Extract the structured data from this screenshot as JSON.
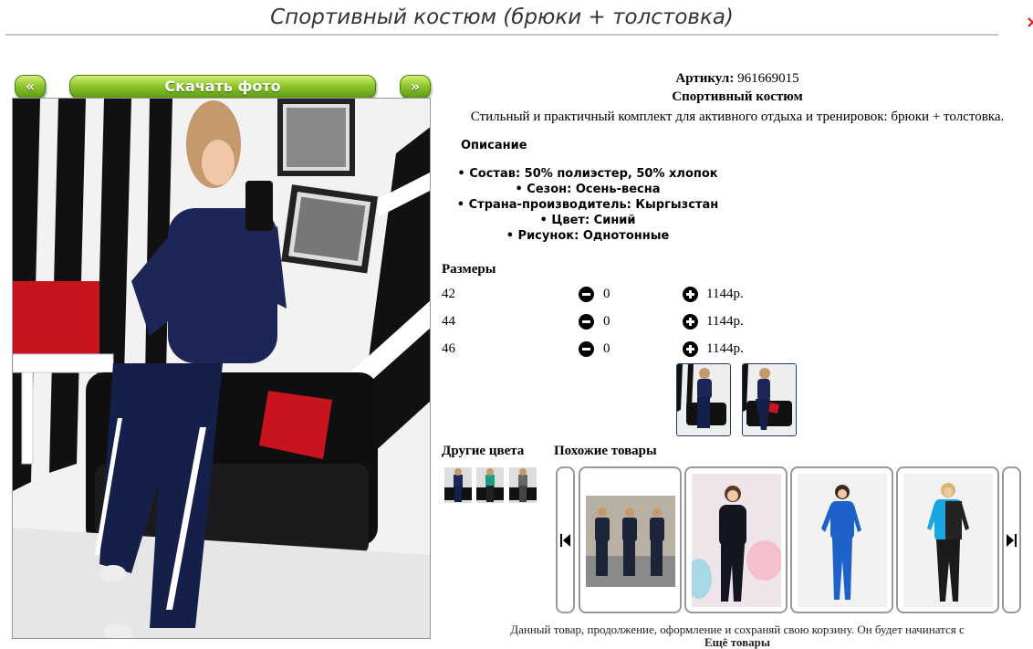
{
  "page": {
    "title": "Спортивный костюм (брюки + толстовка)",
    "close_icon": "close-icon"
  },
  "gallery": {
    "prev_label": "«",
    "download_label": "Скачать фото",
    "next_label": "»"
  },
  "product": {
    "article_label": "Артикул:",
    "article_value": "961669015",
    "name": "Спортивный костюм",
    "description": "Стильный и практичный комплект для активного отдыха и тренировок: брюки + толстовка."
  },
  "description_section": {
    "heading": "Описание",
    "properties": [
      "Состав: 50% полиэстер, 50% хлопок",
      "Сезон: Осень-весна",
      "Страна-производитель: Кыргызстан",
      "Цвет: Синий",
      "Рисунок: Однотонные"
    ]
  },
  "sizes": {
    "heading": "Размеры",
    "rows": [
      {
        "size": "42",
        "qty": "0",
        "price": "1144р."
      },
      {
        "size": "44",
        "qty": "0",
        "price": "1144р."
      },
      {
        "size": "46",
        "qty": "0",
        "price": "1144р."
      }
    ],
    "minus_icon": "minus-circle-icon",
    "plus_icon": "plus-circle-icon"
  },
  "other_colors": {
    "heading": "Другие цвета"
  },
  "similar": {
    "heading": "Похожие товары",
    "prev_icon": "skip-previous-icon",
    "next_icon": "skip-next-icon"
  },
  "bottom": {
    "text": "Данный товар, продолжение, оформление и сохраняй свою корзину. Он будет начинатся с",
    "more_link": "Ещё товары"
  },
  "colors": {
    "accent_green": "#8fc72c",
    "thumb_border": "#1a3c6e",
    "suit_navy": "#1c2757",
    "close_red": "#e01818"
  }
}
